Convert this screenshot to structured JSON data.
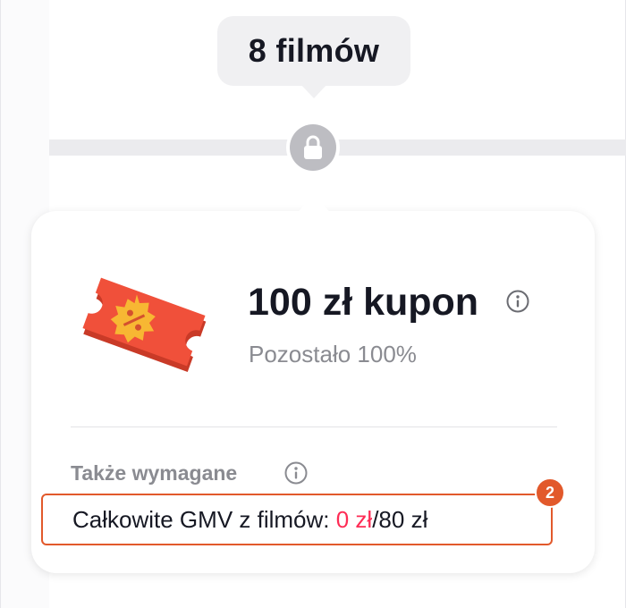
{
  "milestone": {
    "label": "8 filmów"
  },
  "reward": {
    "title": "100 zł kupon",
    "remaining": "Pozostało 100%",
    "icon": "coupon-percent-icon"
  },
  "requirement": {
    "heading": "Także wymagane",
    "prefix": "Całkowite GMV z filmów: ",
    "current": "0 zł",
    "target": "/80 zł"
  },
  "annotation": {
    "step": "2"
  },
  "colors": {
    "accent_red": "#fe2c55",
    "highlight_orange": "#e2592b",
    "coupon": "#f0503a",
    "coupon_badge": "#f7b733"
  }
}
